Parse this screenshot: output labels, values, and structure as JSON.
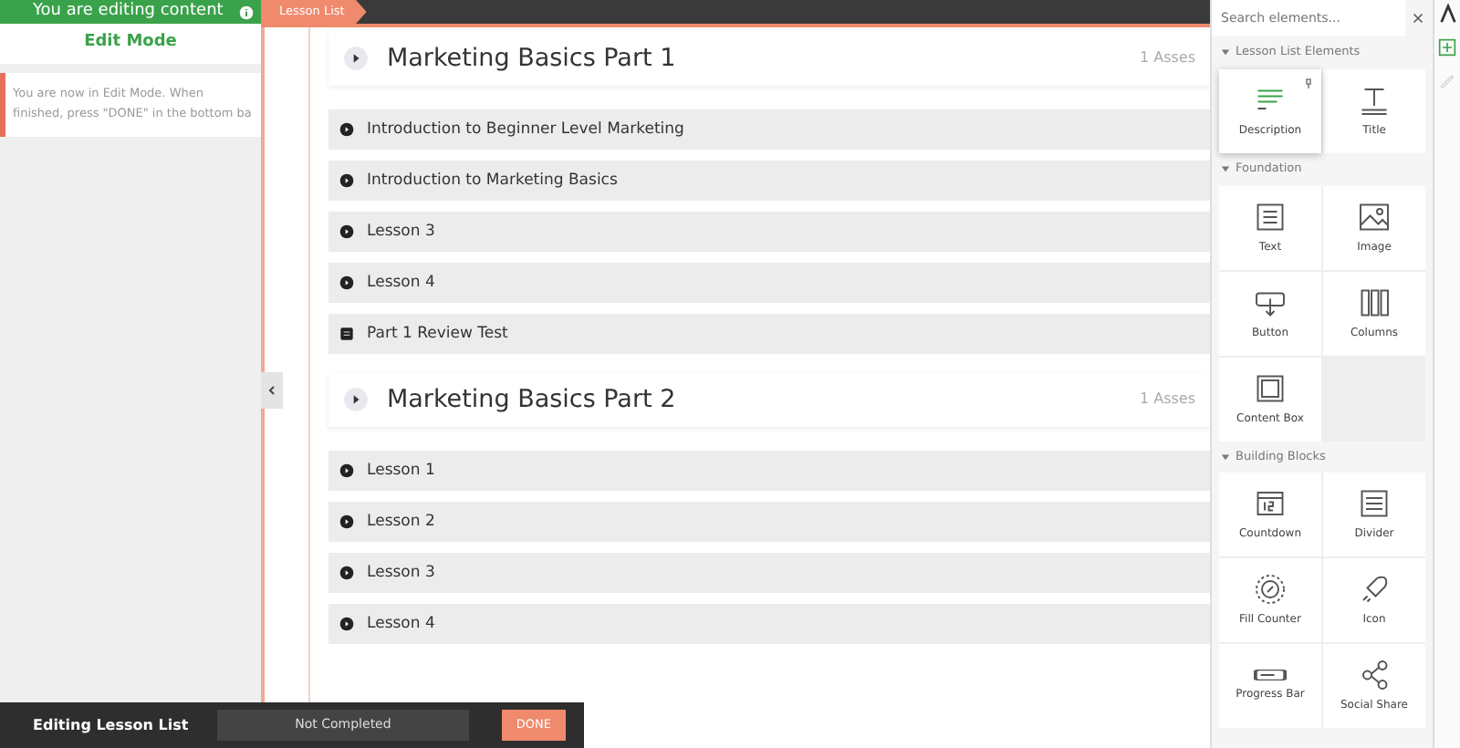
{
  "top_bar": {
    "title": "You are editing content"
  },
  "edit_panel": {
    "heading": "Edit Mode",
    "notice": "You are now in Edit Mode. When finished, press \"DONE\" in the bottom ba"
  },
  "editor_tab": {
    "label": "Lesson List"
  },
  "sections": [
    {
      "title": "Marketing Basics Part 1",
      "meta": "1 Asses",
      "lessons": [
        {
          "title": "Introduction to Beginner Level Marketing",
          "kind": "lesson"
        },
        {
          "title": "Introduction to Marketing Basics",
          "kind": "lesson"
        },
        {
          "title": "Lesson 3",
          "kind": "lesson"
        },
        {
          "title": "Lesson 4",
          "kind": "lesson"
        },
        {
          "title": "Part 1 Review Test",
          "kind": "test"
        }
      ]
    },
    {
      "title": "Marketing Basics Part 2",
      "meta": "1 Asses",
      "lessons": [
        {
          "title": "Lesson 1",
          "kind": "lesson"
        },
        {
          "title": "Lesson 2",
          "kind": "lesson"
        },
        {
          "title": "Lesson 3",
          "kind": "lesson"
        },
        {
          "title": "Lesson 4",
          "kind": "lesson"
        }
      ]
    }
  ],
  "elements_panel": {
    "search_placeholder": "Search elements...",
    "groups": [
      {
        "title": "Lesson List Elements",
        "expanded": true,
        "items": [
          {
            "label": "Description",
            "kind": "description",
            "selected": true
          },
          {
            "label": "Title",
            "kind": "title",
            "selected": false
          }
        ]
      },
      {
        "title": "Foundation",
        "expanded": true,
        "items": [
          {
            "label": "Text",
            "kind": "text",
            "selected": false
          },
          {
            "label": "Image",
            "kind": "image",
            "selected": false
          },
          {
            "label": "Button",
            "kind": "button",
            "selected": false
          },
          {
            "label": "Columns",
            "kind": "columns",
            "selected": false
          },
          {
            "label": "Content Box",
            "kind": "box",
            "selected": false
          }
        ]
      },
      {
        "title": "Building Blocks",
        "expanded": true,
        "items": [
          {
            "label": "Countdown",
            "kind": "countdown",
            "selected": false
          },
          {
            "label": "Divider",
            "kind": "divider",
            "selected": false
          },
          {
            "label": "Fill Counter",
            "kind": "counter",
            "selected": false
          },
          {
            "label": "Icon",
            "kind": "rocket",
            "selected": false
          },
          {
            "label": "Progress Bar",
            "kind": "progress",
            "selected": false
          },
          {
            "label": "Social Share",
            "kind": "share",
            "selected": false
          }
        ]
      }
    ]
  },
  "bottom_bar": {
    "title": "Editing Lesson List",
    "status": "Not Completed",
    "done_label": "DONE"
  }
}
